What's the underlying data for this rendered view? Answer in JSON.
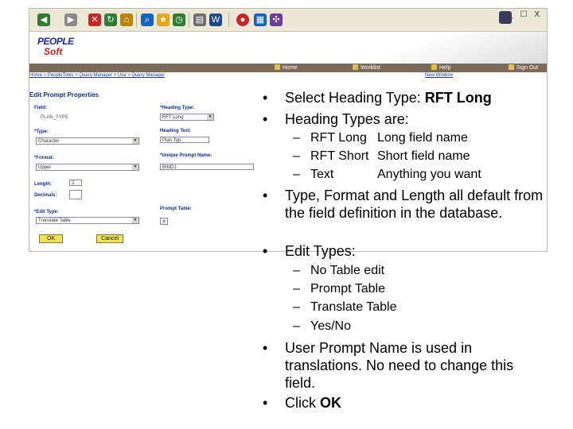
{
  "browser": {
    "window_controls": "_ ☐ X",
    "toolbar_icons": [
      "back-icon",
      "forward-icon",
      "stop-icon",
      "refresh-icon",
      "home-icon",
      "search-icon",
      "favorites-icon",
      "history-icon",
      "print-icon",
      "edit-icon",
      "messenger-icon",
      "grid-icon",
      "people-icon"
    ]
  },
  "app": {
    "logo_line1": "PEOPLE",
    "logo_line2": "Soft",
    "nav": [
      "Home",
      "Worklist",
      "Help",
      "Sign Out"
    ],
    "breadcrumb": "Home > PeopleTools > Query Manager > Use > Query Manager",
    "new_window": "New Window",
    "page_heading": "Edit Prompt Properties",
    "form": {
      "field_label": "Field:",
      "field_value": "PLAN_TYPE",
      "type_label": "*Type:",
      "type_value": "Character",
      "format_label": "*Format:",
      "format_value": "Upper",
      "length_label": "Length:",
      "length_value": "2",
      "decimals_label": "Decimals:",
      "decimals_value": "",
      "edit_type_label": "*Edit Type:",
      "edit_type_value": "Translate Table",
      "heading_type_label": "*Heading Type:",
      "heading_type_value": "RFT Long",
      "heading_text_label": "Heading Text:",
      "heading_text_value": "Plan Typ",
      "unique_prompt_label": "*Unique Prompt Name:",
      "unique_prompt_value": "BIND1",
      "prompt_table_label": "Prompt Table:",
      "ok_button": "OK",
      "cancel_button": "Cancel"
    }
  },
  "slide": {
    "bullet": "•",
    "dash": "–",
    "b_heading_type_pre": "Select Heading Type: ",
    "b_heading_type_bold": "RFT Long",
    "b_heading_types": "Heading Types are:",
    "sub_heading": [
      {
        "term": "RFT Long",
        "desc": "Long field name"
      },
      {
        "term": "RFT Short",
        "desc": "Short field name"
      },
      {
        "term": "Text",
        "desc": "Anything you want"
      }
    ],
    "b_defaults": "Type, Format and Length all default from the field definition in the database.",
    "b_edit_types": "Edit Types:",
    "sub_edit": [
      "No Table edit",
      "Prompt Table",
      "Translate Table",
      "Yes/No"
    ],
    "b_user_prompt": "User Prompt Name is used in translations.  No need to change this field.",
    "b_click_pre": "Click ",
    "b_click_bold": "OK"
  },
  "colors": {
    "nav_bar": "#7a6b58",
    "label_blue": "#1c2c88",
    "button_yellow": "#f2e44e",
    "link_blue": "#1a3d9e"
  }
}
